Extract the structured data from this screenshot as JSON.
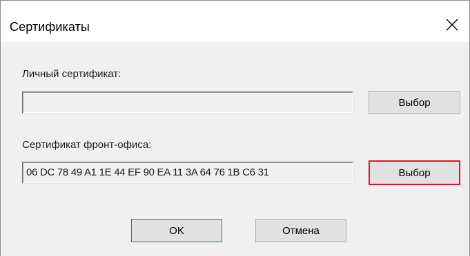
{
  "window": {
    "title": "Сертификаты",
    "close_icon": "close-icon"
  },
  "personal_certificate": {
    "label": "Личный сертификат:",
    "value": "",
    "select_label": "Выбор"
  },
  "front_office_certificate": {
    "label": "Сертификат фронт-офиса:",
    "value": "06 DC 78 49 A1 1E 44 EF 90 EA 11 3A 64 76 1B C6 31",
    "select_label": "Выбор"
  },
  "footer": {
    "ok_label": "OK",
    "cancel_label": "Отмена"
  },
  "colors": {
    "highlight_border": "#e81123",
    "client_background": "#f0f0f0",
    "button_background": "#e1e1e1"
  }
}
